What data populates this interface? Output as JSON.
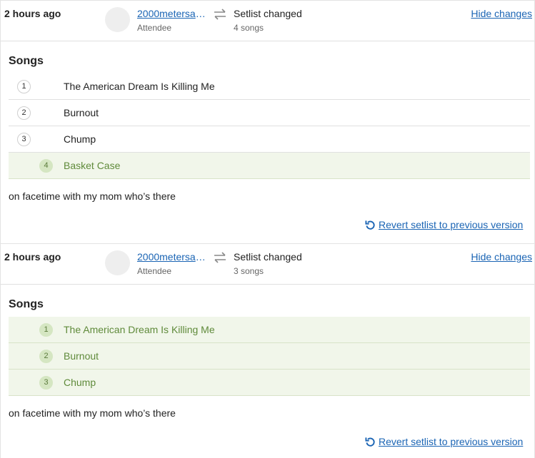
{
  "colors": {
    "link": "#1a64b4",
    "added_bg": "#f1f6ea",
    "added_text": "#5f8a3a",
    "added_badge": "#d5e6c2"
  },
  "entries": [
    {
      "time": "2 hours ago",
      "user": "2000metersaway",
      "role": "Attendee",
      "change_title": "Setlist changed",
      "change_sub": "4 songs",
      "hide_label": "Hide changes",
      "songs_heading": "Songs",
      "songs": [
        {
          "number": "1",
          "name": "The American Dream Is Killing Me",
          "added": false
        },
        {
          "number": "2",
          "name": "Burnout",
          "added": false
        },
        {
          "number": "3",
          "name": "Chump",
          "added": false
        },
        {
          "number": "4",
          "name": "Basket Case",
          "added": true
        }
      ],
      "note": "on facetime with my mom who’s there",
      "revert_label": "Revert setlist to previous version"
    },
    {
      "time": "2 hours ago",
      "user": "2000metersaway",
      "role": "Attendee",
      "change_title": "Setlist changed",
      "change_sub": "3 songs",
      "hide_label": "Hide changes",
      "songs_heading": "Songs",
      "songs": [
        {
          "number": "1",
          "name": "The American Dream Is Killing Me",
          "added": true
        },
        {
          "number": "2",
          "name": "Burnout",
          "added": true
        },
        {
          "number": "3",
          "name": "Chump",
          "added": true
        }
      ],
      "note": "on facetime with my mom who’s there",
      "revert_label": "Revert setlist to previous version"
    }
  ]
}
